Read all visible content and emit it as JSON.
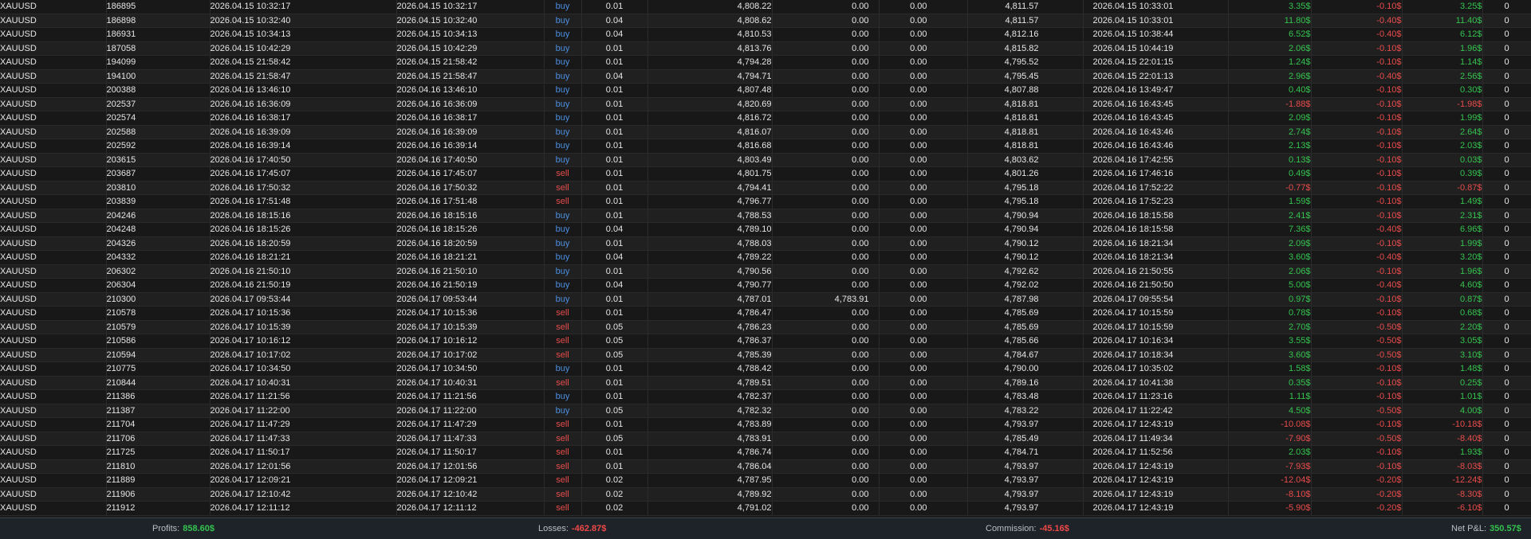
{
  "rows": [
    [
      "XAUUSD",
      "186895",
      "2026.04.15 10:32:17",
      "2026.04.15 10:32:17",
      "buy",
      "0.01",
      "4,808.22",
      "0.00",
      "0.00",
      "4,811.57",
      "2026.04.15 10:33:01",
      "3.35$",
      "-0.10$",
      "3.25$",
      "0"
    ],
    [
      "XAUUSD",
      "186898",
      "2026.04.15 10:32:40",
      "2026.04.15 10:32:40",
      "buy",
      "0.04",
      "4,808.62",
      "0.00",
      "0.00",
      "4,811.57",
      "2026.04.15 10:33:01",
      "11.80$",
      "-0.40$",
      "11.40$",
      "0"
    ],
    [
      "XAUUSD",
      "186931",
      "2026.04.15 10:34:13",
      "2026.04.15 10:34:13",
      "buy",
      "0.04",
      "4,810.53",
      "0.00",
      "0.00",
      "4,812.16",
      "2026.04.15 10:38:44",
      "6.52$",
      "-0.40$",
      "6.12$",
      "0"
    ],
    [
      "XAUUSD",
      "187058",
      "2026.04.15 10:42:29",
      "2026.04.15 10:42:29",
      "buy",
      "0.01",
      "4,813.76",
      "0.00",
      "0.00",
      "4,815.82",
      "2026.04.15 10:44:19",
      "2.06$",
      "-0.10$",
      "1.96$",
      "0"
    ],
    [
      "XAUUSD",
      "194099",
      "2026.04.15 21:58:42",
      "2026.04.15 21:58:42",
      "buy",
      "0.01",
      "4,794.28",
      "0.00",
      "0.00",
      "4,795.52",
      "2026.04.15 22:01:15",
      "1.24$",
      "-0.10$",
      "1.14$",
      "0"
    ],
    [
      "XAUUSD",
      "194100",
      "2026.04.15 21:58:47",
      "2026.04.15 21:58:47",
      "buy",
      "0.04",
      "4,794.71",
      "0.00",
      "0.00",
      "4,795.45",
      "2026.04.15 22:01:13",
      "2.96$",
      "-0.40$",
      "2.56$",
      "0"
    ],
    [
      "XAUUSD",
      "200388",
      "2026.04.16 13:46:10",
      "2026.04.16 13:46:10",
      "buy",
      "0.01",
      "4,807.48",
      "0.00",
      "0.00",
      "4,807.88",
      "2026.04.16 13:49:47",
      "0.40$",
      "-0.10$",
      "0.30$",
      "0"
    ],
    [
      "XAUUSD",
      "202537",
      "2026.04.16 16:36:09",
      "2026.04.16 16:36:09",
      "buy",
      "0.01",
      "4,820.69",
      "0.00",
      "0.00",
      "4,818.81",
      "2026.04.16 16:43:45",
      "-1.88$",
      "-0.10$",
      "-1.98$",
      "0"
    ],
    [
      "XAUUSD",
      "202574",
      "2026.04.16 16:38:17",
      "2026.04.16 16:38:17",
      "buy",
      "0.01",
      "4,816.72",
      "0.00",
      "0.00",
      "4,818.81",
      "2026.04.16 16:43:45",
      "2.09$",
      "-0.10$",
      "1.99$",
      "0"
    ],
    [
      "XAUUSD",
      "202588",
      "2026.04.16 16:39:09",
      "2026.04.16 16:39:09",
      "buy",
      "0.01",
      "4,816.07",
      "0.00",
      "0.00",
      "4,818.81",
      "2026.04.16 16:43:46",
      "2.74$",
      "-0.10$",
      "2.64$",
      "0"
    ],
    [
      "XAUUSD",
      "202592",
      "2026.04.16 16:39:14",
      "2026.04.16 16:39:14",
      "buy",
      "0.01",
      "4,816.68",
      "0.00",
      "0.00",
      "4,818.81",
      "2026.04.16 16:43:46",
      "2.13$",
      "-0.10$",
      "2.03$",
      "0"
    ],
    [
      "XAUUSD",
      "203615",
      "2026.04.16 17:40:50",
      "2026.04.16 17:40:50",
      "buy",
      "0.01",
      "4,803.49",
      "0.00",
      "0.00",
      "4,803.62",
      "2026.04.16 17:42:55",
      "0.13$",
      "-0.10$",
      "0.03$",
      "0"
    ],
    [
      "XAUUSD",
      "203687",
      "2026.04.16 17:45:07",
      "2026.04.16 17:45:07",
      "sell",
      "0.01",
      "4,801.75",
      "0.00",
      "0.00",
      "4,801.26",
      "2026.04.16 17:46:16",
      "0.49$",
      "-0.10$",
      "0.39$",
      "0"
    ],
    [
      "XAUUSD",
      "203810",
      "2026.04.16 17:50:32",
      "2026.04.16 17:50:32",
      "sell",
      "0.01",
      "4,794.41",
      "0.00",
      "0.00",
      "4,795.18",
      "2026.04.16 17:52:22",
      "-0.77$",
      "-0.10$",
      "-0.87$",
      "0"
    ],
    [
      "XAUUSD",
      "203839",
      "2026.04.16 17:51:48",
      "2026.04.16 17:51:48",
      "sell",
      "0.01",
      "4,796.77",
      "0.00",
      "0.00",
      "4,795.18",
      "2026.04.16 17:52:23",
      "1.59$",
      "-0.10$",
      "1.49$",
      "0"
    ],
    [
      "XAUUSD",
      "204246",
      "2026.04.16 18:15:16",
      "2026.04.16 18:15:16",
      "buy",
      "0.01",
      "4,788.53",
      "0.00",
      "0.00",
      "4,790.94",
      "2026.04.16 18:15:58",
      "2.41$",
      "-0.10$",
      "2.31$",
      "0"
    ],
    [
      "XAUUSD",
      "204248",
      "2026.04.16 18:15:26",
      "2026.04.16 18:15:26",
      "buy",
      "0.04",
      "4,789.10",
      "0.00",
      "0.00",
      "4,790.94",
      "2026.04.16 18:15:58",
      "7.36$",
      "-0.40$",
      "6.96$",
      "0"
    ],
    [
      "XAUUSD",
      "204326",
      "2026.04.16 18:20:59",
      "2026.04.16 18:20:59",
      "buy",
      "0.01",
      "4,788.03",
      "0.00",
      "0.00",
      "4,790.12",
      "2026.04.16 18:21:34",
      "2.09$",
      "-0.10$",
      "1.99$",
      "0"
    ],
    [
      "XAUUSD",
      "204332",
      "2026.04.16 18:21:21",
      "2026.04.16 18:21:21",
      "buy",
      "0.04",
      "4,789.22",
      "0.00",
      "0.00",
      "4,790.12",
      "2026.04.16 18:21:34",
      "3.60$",
      "-0.40$",
      "3.20$",
      "0"
    ],
    [
      "XAUUSD",
      "206302",
      "2026.04.16 21:50:10",
      "2026.04.16 21:50:10",
      "buy",
      "0.01",
      "4,790.56",
      "0.00",
      "0.00",
      "4,792.62",
      "2026.04.16 21:50:55",
      "2.06$",
      "-0.10$",
      "1.96$",
      "0"
    ],
    [
      "XAUUSD",
      "206304",
      "2026.04.16 21:50:19",
      "2026.04.16 21:50:19",
      "buy",
      "0.04",
      "4,790.77",
      "0.00",
      "0.00",
      "4,792.02",
      "2026.04.16 21:50:50",
      "5.00$",
      "-0.40$",
      "4.60$",
      "0"
    ],
    [
      "XAUUSD",
      "210300",
      "2026.04.17 09:53:44",
      "2026.04.17 09:53:44",
      "buy",
      "0.01",
      "4,787.01",
      "4,783.91",
      "0.00",
      "4,787.98",
      "2026.04.17 09:55:54",
      "0.97$",
      "-0.10$",
      "0.87$",
      "0"
    ],
    [
      "XAUUSD",
      "210578",
      "2026.04.17 10:15:36",
      "2026.04.17 10:15:36",
      "sell",
      "0.01",
      "4,786.47",
      "0.00",
      "0.00",
      "4,785.69",
      "2026.04.17 10:15:59",
      "0.78$",
      "-0.10$",
      "0.68$",
      "0"
    ],
    [
      "XAUUSD",
      "210579",
      "2026.04.17 10:15:39",
      "2026.04.17 10:15:39",
      "sell",
      "0.05",
      "4,786.23",
      "0.00",
      "0.00",
      "4,785.69",
      "2026.04.17 10:15:59",
      "2.70$",
      "-0.50$",
      "2.20$",
      "0"
    ],
    [
      "XAUUSD",
      "210586",
      "2026.04.17 10:16:12",
      "2026.04.17 10:16:12",
      "sell",
      "0.05",
      "4,786.37",
      "0.00",
      "0.00",
      "4,785.66",
      "2026.04.17 10:16:34",
      "3.55$",
      "-0.50$",
      "3.05$",
      "0"
    ],
    [
      "XAUUSD",
      "210594",
      "2026.04.17 10:17:02",
      "2026.04.17 10:17:02",
      "sell",
      "0.05",
      "4,785.39",
      "0.00",
      "0.00",
      "4,784.67",
      "2026.04.17 10:18:34",
      "3.60$",
      "-0.50$",
      "3.10$",
      "0"
    ],
    [
      "XAUUSD",
      "210775",
      "2026.04.17 10:34:50",
      "2026.04.17 10:34:50",
      "buy",
      "0.01",
      "4,788.42",
      "0.00",
      "0.00",
      "4,790.00",
      "2026.04.17 10:35:02",
      "1.58$",
      "-0.10$",
      "1.48$",
      "0"
    ],
    [
      "XAUUSD",
      "210844",
      "2026.04.17 10:40:31",
      "2026.04.17 10:40:31",
      "sell",
      "0.01",
      "4,789.51",
      "0.00",
      "0.00",
      "4,789.16",
      "2026.04.17 10:41:38",
      "0.35$",
      "-0.10$",
      "0.25$",
      "0"
    ],
    [
      "XAUUSD",
      "211386",
      "2026.04.17 11:21:56",
      "2026.04.17 11:21:56",
      "buy",
      "0.01",
      "4,782.37",
      "0.00",
      "0.00",
      "4,783.48",
      "2026.04.17 11:23:16",
      "1.11$",
      "-0.10$",
      "1.01$",
      "0"
    ],
    [
      "XAUUSD",
      "211387",
      "2026.04.17 11:22:00",
      "2026.04.17 11:22:00",
      "buy",
      "0.05",
      "4,782.32",
      "0.00",
      "0.00",
      "4,783.22",
      "2026.04.17 11:22:42",
      "4.50$",
      "-0.50$",
      "4.00$",
      "0"
    ],
    [
      "XAUUSD",
      "211704",
      "2026.04.17 11:47:29",
      "2026.04.17 11:47:29",
      "sell",
      "0.01",
      "4,783.89",
      "0.00",
      "0.00",
      "4,793.97",
      "2026.04.17 12:43:19",
      "-10.08$",
      "-0.10$",
      "-10.18$",
      "0"
    ],
    [
      "XAUUSD",
      "211706",
      "2026.04.17 11:47:33",
      "2026.04.17 11:47:33",
      "sell",
      "0.05",
      "4,783.91",
      "0.00",
      "0.00",
      "4,785.49",
      "2026.04.17 11:49:34",
      "-7.90$",
      "-0.50$",
      "-8.40$",
      "0"
    ],
    [
      "XAUUSD",
      "211725",
      "2026.04.17 11:50:17",
      "2026.04.17 11:50:17",
      "sell",
      "0.01",
      "4,786.74",
      "0.00",
      "0.00",
      "4,784.71",
      "2026.04.17 11:52:56",
      "2.03$",
      "-0.10$",
      "1.93$",
      "0"
    ],
    [
      "XAUUSD",
      "211810",
      "2026.04.17 12:01:56",
      "2026.04.17 12:01:56",
      "sell",
      "0.01",
      "4,786.04",
      "0.00",
      "0.00",
      "4,793.97",
      "2026.04.17 12:43:19",
      "-7.93$",
      "-0.10$",
      "-8.03$",
      "0"
    ],
    [
      "XAUUSD",
      "211889",
      "2026.04.17 12:09:21",
      "2026.04.17 12:09:21",
      "sell",
      "0.02",
      "4,787.95",
      "0.00",
      "0.00",
      "4,793.97",
      "2026.04.17 12:43:19",
      "-12.04$",
      "-0.20$",
      "-12.24$",
      "0"
    ],
    [
      "XAUUSD",
      "211906",
      "2026.04.17 12:10:42",
      "2026.04.17 12:10:42",
      "sell",
      "0.02",
      "4,789.92",
      "0.00",
      "0.00",
      "4,793.97",
      "2026.04.17 12:43:19",
      "-8.10$",
      "-0.20$",
      "-8.30$",
      "0"
    ],
    [
      "XAUUSD",
      "211912",
      "2026.04.17 12:11:12",
      "2026.04.17 12:11:12",
      "sell",
      "0.02",
      "4,791.02",
      "0.00",
      "0.00",
      "4,793.97",
      "2026.04.17 12:43:19",
      "-5.90$",
      "-0.20$",
      "-6.10$",
      "0"
    ]
  ],
  "footer": {
    "profits_label": "Profits:",
    "profits_value": "858.60$",
    "losses_label": "Losses:",
    "losses_value": "-462.87$",
    "commission_label": "Commission:",
    "commission_value": "-45.16$",
    "net_label": "Net P&L:",
    "net_value": "350.57$"
  },
  "colors": {
    "buy": "#4d8fe3",
    "sell": "#e84c4c",
    "positive": "#35c24f",
    "negative": "#e84c4c"
  }
}
